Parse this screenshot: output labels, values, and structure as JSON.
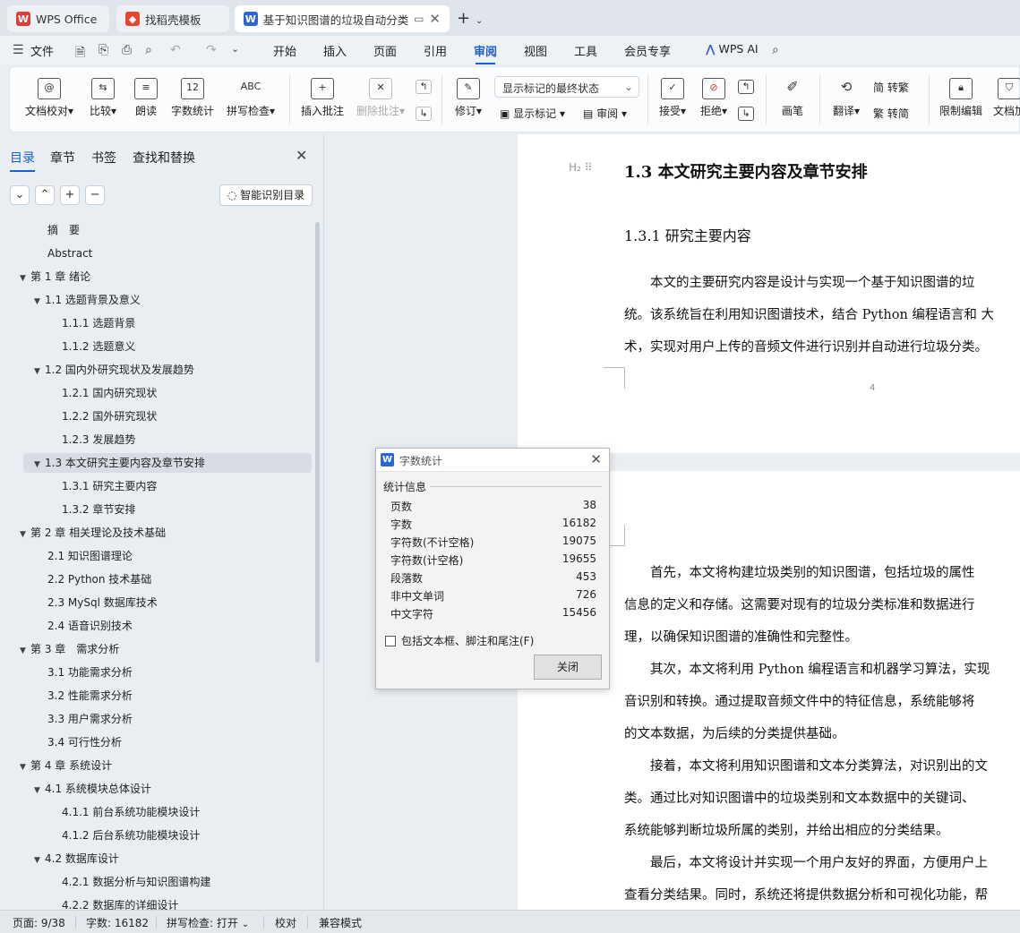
{
  "tabs": {
    "wps_office": "WPS Office",
    "daoke": "找稻壳模板",
    "doc_title": "基于知识图谱的垃圾自动分类",
    "new_tab": "+"
  },
  "menu": {
    "file": "文件",
    "items": [
      "开始",
      "插入",
      "页面",
      "引用",
      "审阅",
      "视图",
      "工具",
      "会员专享"
    ],
    "active": "审阅",
    "wps_ai": "WPS AI"
  },
  "ribbon": {
    "doc_check": "文档校对",
    "compare": "比较",
    "read_aloud": "朗读",
    "word_count": "字数统计",
    "spell_check": "拼写检查",
    "insert_comment": "插入批注",
    "delete_comment": "删除批注",
    "revise": "修订",
    "markup_state": "显示标记的最终状态",
    "show_markup": "显示标记",
    "review": "审阅",
    "accept": "接受",
    "reject": "拒绝",
    "pen": "画笔",
    "translate": "翻译",
    "to_traditional": "简 转繁",
    "to_simplified": "繁 转简",
    "restrict_edit": "限制编辑",
    "doc_protect": "文档加"
  },
  "nav": {
    "tabs": [
      "目录",
      "章节",
      "书签",
      "查找和替换"
    ],
    "active_tab": "目录",
    "smart_toc": "智能识别目录",
    "items": [
      {
        "label": "摘　要",
        "level": 1,
        "tri": ""
      },
      {
        "label": "Abstract",
        "level": 1,
        "tri": ""
      },
      {
        "label": "第 1 章  绪论",
        "level": 0,
        "tri": "▼"
      },
      {
        "label": "1.1  选题背景及意义",
        "level": 1,
        "tri": "▼"
      },
      {
        "label": "1.1.1  选题背景",
        "level": 2,
        "tri": ""
      },
      {
        "label": "1.1.2  选题意义",
        "level": 2,
        "tri": ""
      },
      {
        "label": "1.2  国内外研究现状及发展趋势",
        "level": 1,
        "tri": "▼"
      },
      {
        "label": "1.2.1  国内研究现状",
        "level": 2,
        "tri": ""
      },
      {
        "label": "1.2.2  国外研究现状",
        "level": 2,
        "tri": ""
      },
      {
        "label": "1.2.3  发展趋势",
        "level": 2,
        "tri": ""
      },
      {
        "label": "1.3  本文研究主要内容及章节安排",
        "level": 1,
        "tri": "▼",
        "selected": true
      },
      {
        "label": "1.3.1  研究主要内容",
        "level": 2,
        "tri": ""
      },
      {
        "label": "1.3.2  章节安排",
        "level": 2,
        "tri": ""
      },
      {
        "label": "第 2 章  相关理论及技术基础",
        "level": 0,
        "tri": "▼"
      },
      {
        "label": "2.1  知识图谱理论",
        "level": 1,
        "tri": ""
      },
      {
        "label": "2.2 Python 技术基础",
        "level": 1,
        "tri": ""
      },
      {
        "label": "2.3 MySql 数据库技术",
        "level": 1,
        "tri": ""
      },
      {
        "label": "2.4  语音识别技术",
        "level": 1,
        "tri": ""
      },
      {
        "label": "第 3 章　需求分析",
        "level": 0,
        "tri": "▼"
      },
      {
        "label": "3.1  功能需求分析",
        "level": 1,
        "tri": ""
      },
      {
        "label": "3.2  性能需求分析",
        "level": 1,
        "tri": ""
      },
      {
        "label": "3.3  用户需求分析",
        "level": 1,
        "tri": ""
      },
      {
        "label": "3.4  可行性分析",
        "level": 1,
        "tri": ""
      },
      {
        "label": "第 4 章  系统设计",
        "level": 0,
        "tri": "▼"
      },
      {
        "label": "4.1  系统模块总体设计",
        "level": 1,
        "tri": "▼"
      },
      {
        "label": "4.1.1  前台系统功能模块设计",
        "level": 2,
        "tri": ""
      },
      {
        "label": "4.1.2  后台系统功能模块设计",
        "level": 2,
        "tri": ""
      },
      {
        "label": "4.2  数据库设计",
        "level": 1,
        "tri": "▼"
      },
      {
        "label": "4.2.1  数据分析与知识图谱构建",
        "level": 2,
        "tri": ""
      },
      {
        "label": "4.2.2  数据库的详细设计",
        "level": 2,
        "tri": ""
      }
    ]
  },
  "document": {
    "h2_marker": "H₂",
    "h2": "1.3  本文研究主要内容及章节安排",
    "h3": "1.3.1  研究主要内容",
    "page1_lines": [
      "　　本文的主要研究内容是设计与实现一个基于知识图谱的垃",
      "统。该系统旨在利用知识图谱技术，结合 Python 编程语言和 大",
      "术，实现对用户上传的音频文件进行识别并自动进行垃圾分类。"
    ],
    "page_number": "4",
    "page2_lines": [
      "　　首先，本文将构建垃圾类别的知识图谱，包括垃圾的属性",
      "信息的定义和存储。这需要对现有的垃圾分类标准和数据进行",
      "理，以确保知识图谱的准确性和完整性。",
      "　　其次，本文将利用 Python 编程语言和机器学习算法，实现",
      "音识别和转换。通过提取音频文件中的特征信息，系统能够将",
      "的文本数据，为后续的分类提供基础。",
      "　　接着，本文将利用知识图谱和文本分类算法，对识别出的文",
      "类。通过比对知识图谱中的垃圾类别和文本数据中的关键词、",
      "系统能够判断垃圾所属的类别，并给出相应的分类结果。",
      "　　最后，本文将设计并实现一个用户友好的界面，方便用户上",
      "查看分类结果。同时，系统还将提供数据分析和可视化功能，帮"
    ]
  },
  "dialog": {
    "title": "字数统计",
    "section": "统计信息",
    "stats": [
      {
        "label": "页数",
        "value": "38"
      },
      {
        "label": "字数",
        "value": "16182"
      },
      {
        "label": "字符数(不计空格)",
        "value": "19075"
      },
      {
        "label": "字符数(计空格)",
        "value": "19655"
      },
      {
        "label": "段落数",
        "value": "453"
      },
      {
        "label": "非中文单词",
        "value": "726"
      },
      {
        "label": "中文字符",
        "value": "15456"
      }
    ],
    "checkbox": "包括文本框、脚注和尾注(F)",
    "checkbox_checked": false,
    "close": "关闭"
  },
  "status": {
    "page": "页面: 9/38",
    "words": "字数: 16182",
    "spell": "拼写检查: 打开",
    "proof": "校对",
    "compat": "兼容模式"
  },
  "colors": {
    "accent": "#1a5fd6",
    "wps_red": "#e03a3a",
    "word_blue": "#2b66d9"
  }
}
